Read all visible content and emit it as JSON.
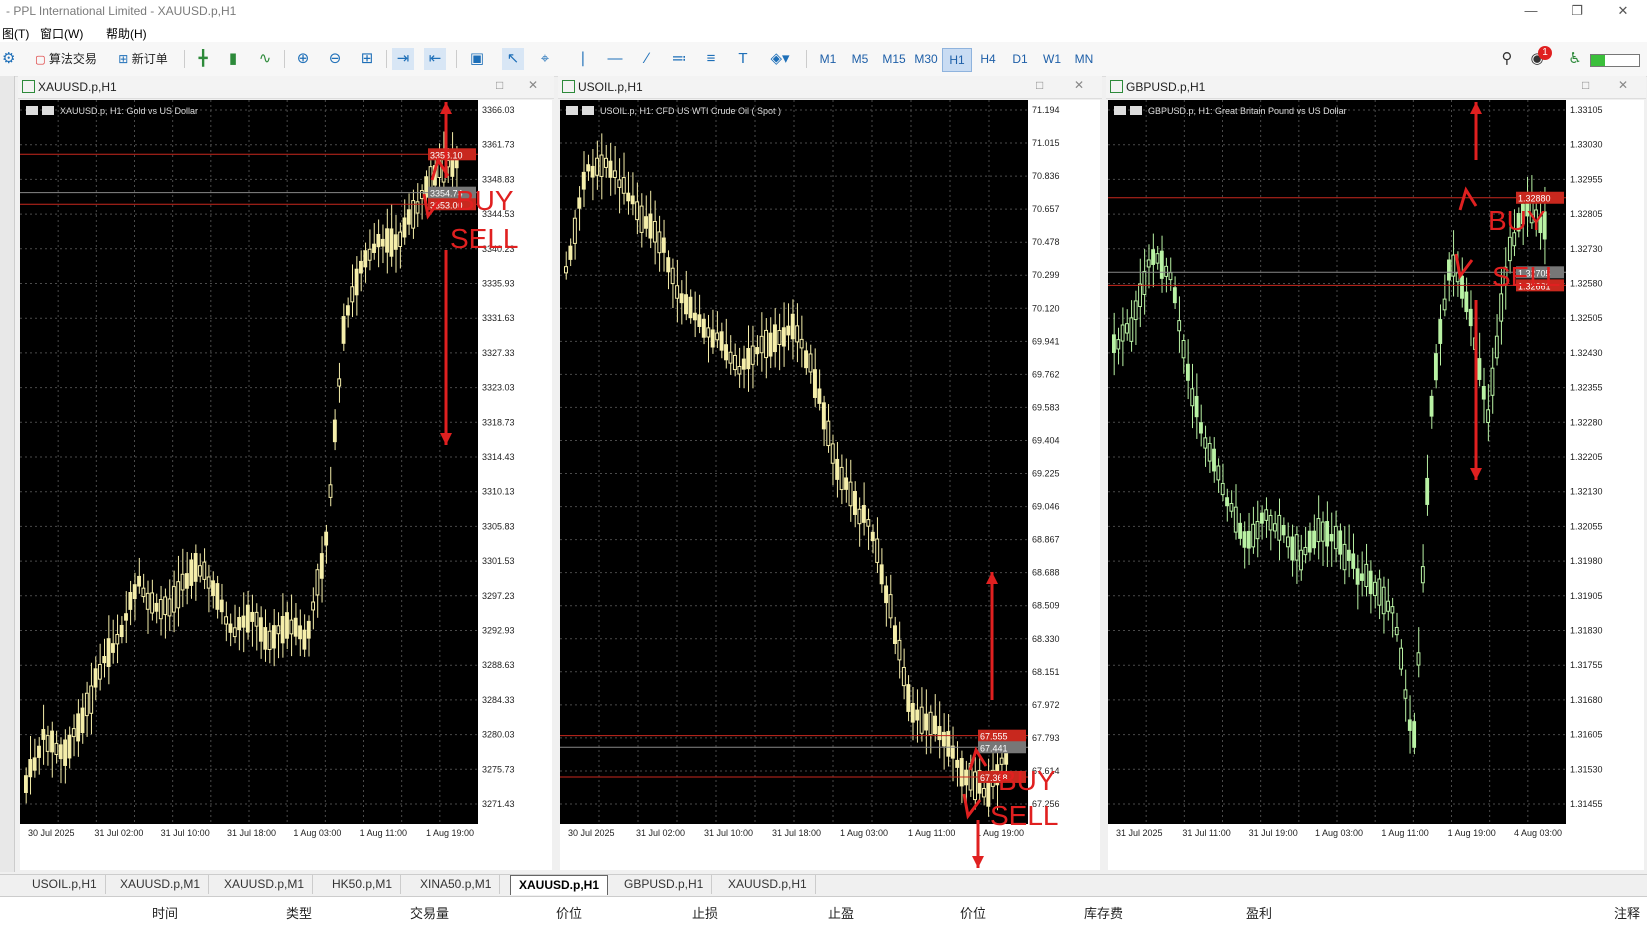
{
  "window": {
    "title": "- PPL International Limited - XAUUSD.p,H1"
  },
  "menu": [
    "图(T)",
    "窗口(W)",
    "帮助(H)"
  ],
  "toolbar": {
    "algo_trading": "算法交易",
    "new_order": "新订单",
    "timeframes": [
      "M1",
      "M5",
      "M15",
      "M30",
      "H1",
      "H4",
      "D1",
      "W1",
      "MN"
    ],
    "active_timeframe": "H1",
    "notification_count": "1"
  },
  "charts": [
    {
      "window_title": "XAUUSD.p,H1",
      "info": "XAUUSD.p, H1:  Gold vs US Dollar",
      "price_labels": [
        "3366.03",
        "3361.73",
        "3348.83",
        "3344.53",
        "3340.23",
        "3335.93",
        "3331.63",
        "3327.33",
        "3323.03",
        "3318.73",
        "3314.43",
        "3310.13",
        "3305.83",
        "3301.53",
        "3297.23",
        "3292.93",
        "3288.63",
        "3284.33",
        "3280.03",
        "3275.73",
        "3271.43"
      ],
      "time_labels": [
        "30 Jul 2025",
        "31 Jul 02:00",
        "31 Jul 10:00",
        "31 Jul 18:00",
        "1 Aug 03:00",
        "1 Aug 11:00",
        "1 Aug 19:00"
      ],
      "line_tags": [
        "3358.10",
        "3354.74",
        "3353.00"
      ],
      "annotations": [
        "BUY",
        "SELL"
      ],
      "candle_color": "#f5eeaa",
      "line_color": "#c8281e"
    },
    {
      "window_title": "USOIL.p,H1",
      "info": "USOIL.p, H1:  CFD US WTI Crude Oil ( Spot )",
      "price_labels": [
        "71.194",
        "71.015",
        "70.836",
        "70.657",
        "70.478",
        "70.299",
        "70.120",
        "69.941",
        "69.762",
        "69.583",
        "69.404",
        "69.225",
        "69.046",
        "68.867",
        "68.688",
        "68.509",
        "68.330",
        "68.151",
        "67.972",
        "67.793",
        "67.614",
        "67.256"
      ],
      "time_labels": [
        "30 Jul 2025",
        "31 Jul 02:00",
        "31 Jul 10:00",
        "31 Jul 18:00",
        "1 Aug 03:00",
        "1 Aug 11:00",
        "1 Aug 19:00"
      ],
      "line_tags": [
        "67.555",
        "67.441",
        "67.368"
      ],
      "annotations": [
        "BUY",
        "SELL"
      ],
      "candle_color": "#f5eeaa",
      "line_color": "#c8281e"
    },
    {
      "window_title": "GBPUSD.p,H1",
      "info": "GBPUSD.p, H1:  Great Britain Pound vs US Dollar",
      "price_labels": [
        "1.33105",
        "1.33030",
        "1.32955",
        "1.32805",
        "1.32730",
        "1.32580",
        "1.32505",
        "1.32430",
        "1.32355",
        "1.32280",
        "1.32205",
        "1.32130",
        "1.32055",
        "1.31980",
        "1.31905",
        "1.31830",
        "1.31755",
        "1.31680",
        "1.31605",
        "1.31530",
        "1.31455"
      ],
      "time_labels": [
        "31 Jul 2025",
        "31 Jul 11:00",
        "31 Jul 19:00",
        "1 Aug 03:00",
        "1 Aug 11:00",
        "1 Aug 19:00",
        "4 Aug 03:00"
      ],
      "line_tags": [
        "1.32880",
        "1.32705",
        "1.32661"
      ],
      "annotations": [
        "BUY",
        "SELL"
      ],
      "candle_color": "#b9f2a4",
      "line_color": "#c8281e"
    }
  ],
  "tabs": [
    "USOIL.p,H1",
    "XAUUSD.p,M1",
    "XAUUSD.p,M1",
    "HK50.p,M1",
    "XINA50.p,M1",
    "XAUUSD.p,H1",
    "GBPUSD.p,H1",
    "XAUUSD.p,H1"
  ],
  "active_tab_index": 5,
  "columns": [
    "时间",
    "类型",
    "交易量",
    "价位",
    "止损",
    "止盈",
    "价位",
    "库存费",
    "盈利",
    "注释"
  ]
}
